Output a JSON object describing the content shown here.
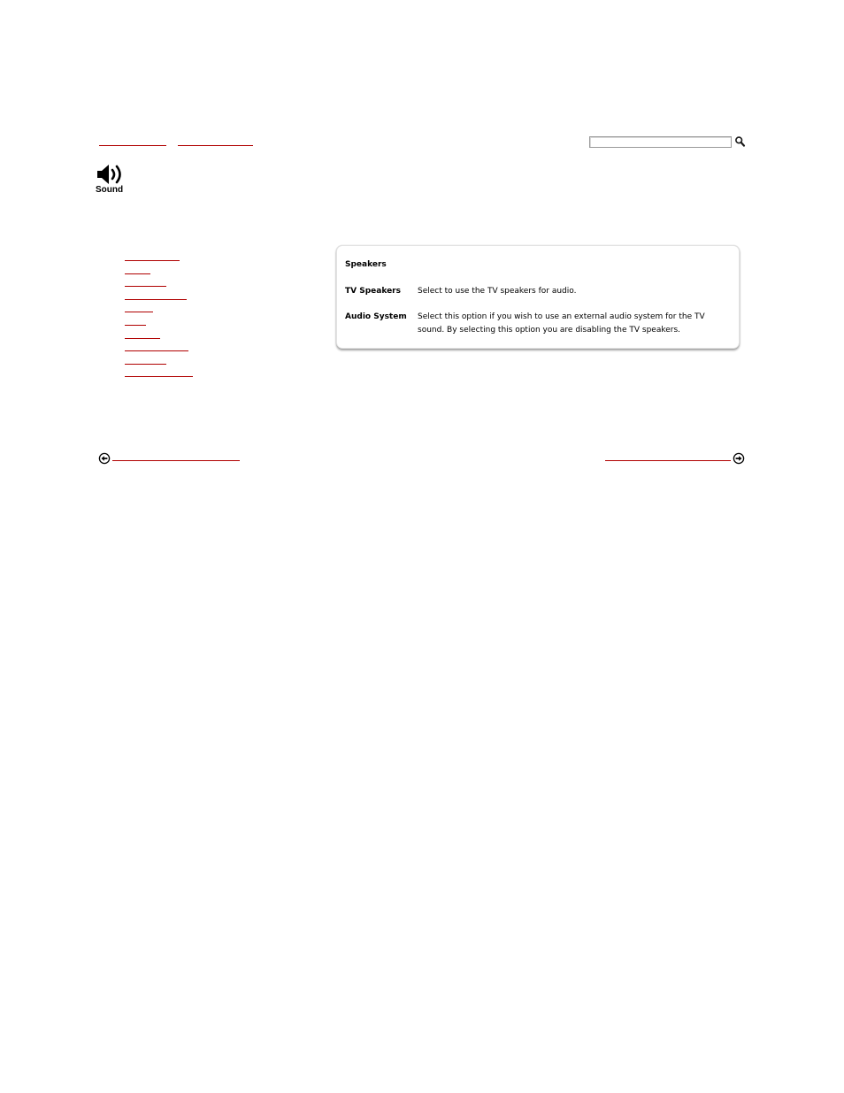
{
  "top_links": [
    "",
    ""
  ],
  "search": {
    "value": "",
    "placeholder": ""
  },
  "sound": {
    "label": "Sound"
  },
  "nav_links": [
    "",
    "",
    "",
    "",
    "",
    "",
    "",
    "",
    "",
    ""
  ],
  "card": {
    "title": "Speakers",
    "rows": [
      {
        "term": "TV Speakers",
        "description": "Select to use the TV speakers for audio."
      },
      {
        "term": "Audio System",
        "description": "Select this option if you wish to use an external audio system for the TV sound. By selecting this option you are disabling the TV speakers."
      }
    ]
  },
  "bottom_nav": {
    "prev_label": "",
    "next_label": ""
  },
  "colors": {
    "link": "#b00000"
  }
}
